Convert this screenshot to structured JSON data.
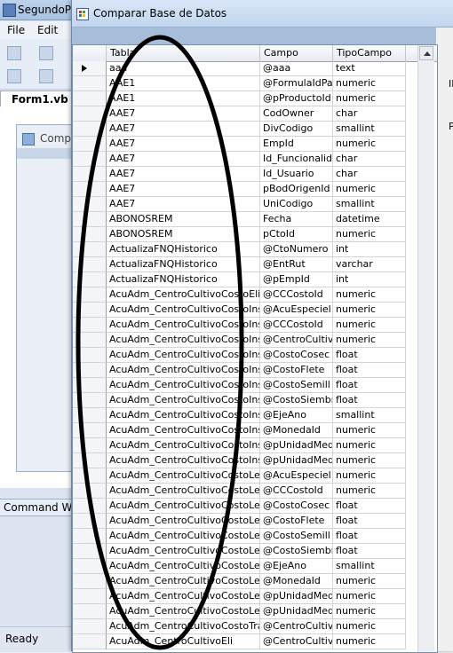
{
  "ide": {
    "title": "SegundoP",
    "menu": [
      "File",
      "Edit"
    ],
    "tab": "Form1.vb [",
    "inner_form_caption": "Comp",
    "command_window": "Command W",
    "status": "Ready"
  },
  "form": {
    "title": "Comparar Base de Datos",
    "side_labels": [
      "IF",
      "P"
    ]
  },
  "grid": {
    "columns": [
      "Tabla",
      "Campo",
      "TipoCampo"
    ],
    "rows": [
      [
        "aaa",
        "@aaa",
        "text"
      ],
      [
        "AAE1",
        "@FormulaIdPa",
        "numeric"
      ],
      [
        "AAE1",
        "@pProductoId",
        "numeric"
      ],
      [
        "AAE7",
        "CodOwner",
        "char"
      ],
      [
        "AAE7",
        "DivCodigo",
        "smallint"
      ],
      [
        "AAE7",
        "EmpId",
        "numeric"
      ],
      [
        "AAE7",
        "Id_Funcionalid",
        "char"
      ],
      [
        "AAE7",
        "Id_Usuario",
        "char"
      ],
      [
        "AAE7",
        "pBodOrigenId",
        "numeric"
      ],
      [
        "AAE7",
        "UniCodigo",
        "smallint"
      ],
      [
        "ABONOSREM",
        "Fecha",
        "datetime"
      ],
      [
        "ABONOSREM",
        "pCtoId",
        "numeric"
      ],
      [
        "ActualizaFNQHistorico",
        "@CtoNumero",
        "int"
      ],
      [
        "ActualizaFNQHistorico",
        "@EntRut",
        "varchar"
      ],
      [
        "ActualizaFNQHistorico",
        "@pEmpId",
        "int"
      ],
      [
        "AcuAdm_CentroCultivoCostoEli",
        "@CCCostoId",
        "numeric"
      ],
      [
        "AcuAdm_CentroCultivoCostoIns",
        "@AcuEspeciel",
        "numeric"
      ],
      [
        "AcuAdm_CentroCultivoCostoIns",
        "@CCCostoId",
        "numeric"
      ],
      [
        "AcuAdm_CentroCultivoCostoIns",
        "@CentroCultiv",
        "numeric"
      ],
      [
        "AcuAdm_CentroCultivoCostoIns",
        "@CostoCosec",
        "float"
      ],
      [
        "AcuAdm_CentroCultivoCostoIns",
        "@CostoFlete",
        "float"
      ],
      [
        "AcuAdm_CentroCultivoCostoIns",
        "@CostoSemill",
        "float"
      ],
      [
        "AcuAdm_CentroCultivoCostoIns",
        "@CostoSiembr",
        "float"
      ],
      [
        "AcuAdm_CentroCultivoCostoIns",
        "@EjeAno",
        "smallint"
      ],
      [
        "AcuAdm_CentroCultivoCostoIns",
        "@MonedaId",
        "numeric"
      ],
      [
        "AcuAdm_CentroCultivoCostoIns",
        "@pUnidadMed",
        "numeric"
      ],
      [
        "AcuAdm_CentroCultivoCostoIns",
        "@pUnidadMed",
        "numeric"
      ],
      [
        "AcuAdm_CentroCultivoCostoLee",
        "@AcuEspeciel",
        "numeric"
      ],
      [
        "AcuAdm_CentroCultivoCostoLee",
        "@CCCostoId",
        "numeric"
      ],
      [
        "AcuAdm_CentroCultivoCostoLee",
        "@CostoCosec",
        "float"
      ],
      [
        "AcuAdm_CentroCultivoCostoLee",
        "@CostoFlete",
        "float"
      ],
      [
        "AcuAdm_CentroCultivoCostoLee",
        "@CostoSemill",
        "float"
      ],
      [
        "AcuAdm_CentroCultivoCostoLee",
        "@CostoSiembr",
        "float"
      ],
      [
        "AcuAdm_CentroCultivoCostoLee",
        "@EjeAno",
        "smallint"
      ],
      [
        "AcuAdm_CentroCultivoCostoLee",
        "@MonedaId",
        "numeric"
      ],
      [
        "AcuAdm_CentroCultivoCostoLee",
        "@pUnidadMed",
        "numeric"
      ],
      [
        "AcuAdm_CentroCultivoCostoLee",
        "@pUnidadMed",
        "numeric"
      ],
      [
        "AcuAdm_CentroCultivoCostoTra",
        "@CentroCultiv",
        "numeric"
      ],
      [
        "AcuAdm_CentroCultivoEli",
        "@CentroCultiv",
        "numeric"
      ]
    ]
  }
}
